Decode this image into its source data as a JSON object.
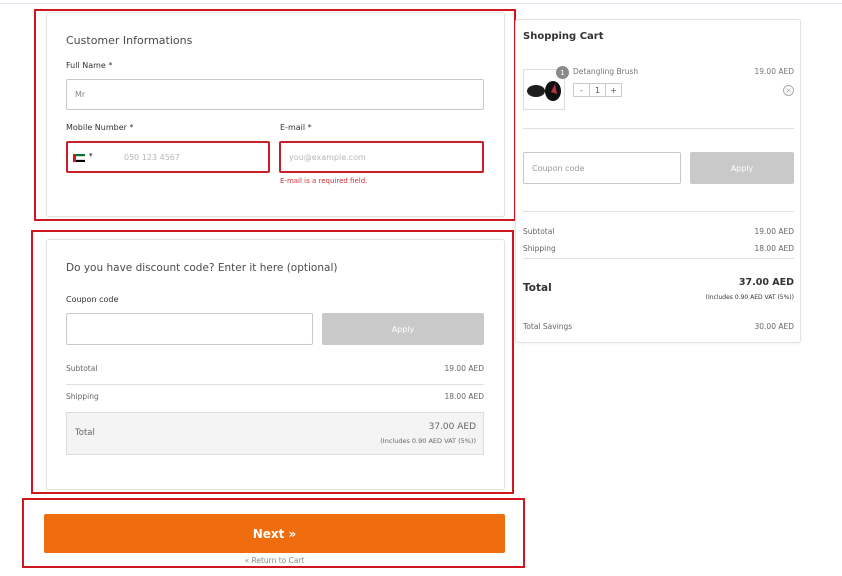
{
  "customer": {
    "title": "Customer Informations",
    "full_name_label": "Full Name *",
    "full_name_value": "Mr",
    "mobile_label": "Mobile Number *",
    "mobile_placeholder": "050 123 4567",
    "email_label": "E-mail *",
    "email_placeholder": "you@example.com",
    "email_error": "E-mail is a required field."
  },
  "discount": {
    "title": "Do you have discount code? Enter it here (optional)",
    "coupon_label": "Coupon code",
    "apply_label": "Apply",
    "subtotal_label": "Subtotal",
    "subtotal_value": "19.00 AED",
    "shipping_label": "Shipping",
    "shipping_value": "18.00 AED",
    "total_label": "Total",
    "total_value": "37.00 AED",
    "total_vat": "(Includes 0.90 AED VAT (5%))"
  },
  "actions": {
    "next_label": "Next »",
    "return_label": "« Return to Cart"
  },
  "cart": {
    "title": "Shopping Cart",
    "item": {
      "name": "Detangling Brush",
      "price": "19.00 AED",
      "qty_badge": "1",
      "qty": "1",
      "minus": "-",
      "plus": "+",
      "remove_icon": "close-circle-icon"
    },
    "coupon_placeholder": "Coupon code",
    "apply_label": "Apply",
    "subtotal_label": "Subtotal",
    "subtotal_value": "19.00 AED",
    "shipping_label": "Shipping",
    "shipping_value": "18.00 AED",
    "total_label": "Total",
    "total_value": "37.00 AED",
    "total_vat": "(Includes 0.90 AED VAT (5%))",
    "savings_label": "Total Savings",
    "savings_value": "30.00 AED"
  },
  "colors": {
    "accent": "#ef6c0f",
    "highlight": "#d0161e",
    "apply_disabled": "#c9c9c9",
    "error": "#d0303a"
  }
}
